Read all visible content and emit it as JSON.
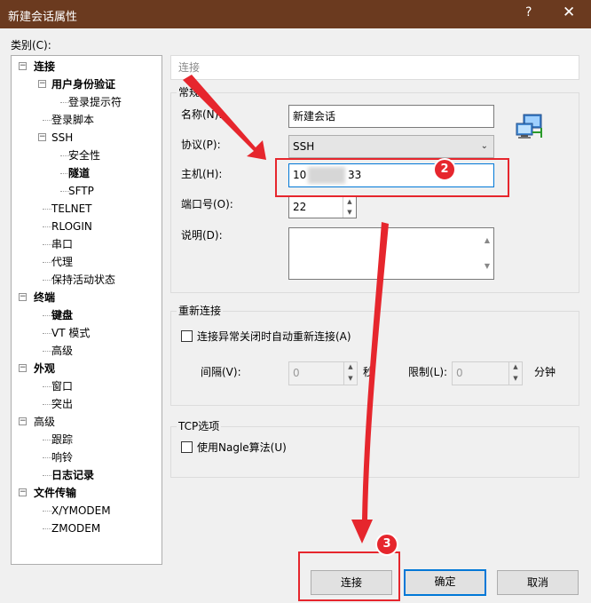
{
  "window": {
    "title": "新建会话属性",
    "help": "?",
    "close": "✕"
  },
  "category_label": "类别(C):",
  "tree": [
    {
      "label": "连接",
      "level": 0,
      "bold": true
    },
    {
      "label": "用户身份验证",
      "level": 1,
      "bold": true
    },
    {
      "label": "登录提示符",
      "level": 2,
      "bold": false
    },
    {
      "label": "登录脚本",
      "level": 1,
      "bold": false
    },
    {
      "label": "SSH",
      "level": 1,
      "bold": false
    },
    {
      "label": "安全性",
      "level": 2,
      "bold": false
    },
    {
      "label": "隧道",
      "level": 2,
      "bold": true
    },
    {
      "label": "SFTP",
      "level": 2,
      "bold": false
    },
    {
      "label": "TELNET",
      "level": 1,
      "bold": false
    },
    {
      "label": "RLOGIN",
      "level": 1,
      "bold": false
    },
    {
      "label": "串口",
      "level": 1,
      "bold": false
    },
    {
      "label": "代理",
      "level": 1,
      "bold": false
    },
    {
      "label": "保持活动状态",
      "level": 1,
      "bold": false
    },
    {
      "label": "终端",
      "level": 0,
      "bold": true
    },
    {
      "label": "键盘",
      "level": 1,
      "bold": true
    },
    {
      "label": "VT 模式",
      "level": 1,
      "bold": false
    },
    {
      "label": "高级",
      "level": 1,
      "bold": false
    },
    {
      "label": "外观",
      "level": 0,
      "bold": true
    },
    {
      "label": "窗口",
      "level": 1,
      "bold": false
    },
    {
      "label": "突出",
      "level": 1,
      "bold": false
    },
    {
      "label": "高级",
      "level": 0,
      "bold": false
    },
    {
      "label": "跟踪",
      "level": 1,
      "bold": false
    },
    {
      "label": "响铃",
      "level": 1,
      "bold": false
    },
    {
      "label": "日志记录",
      "level": 1,
      "bold": true
    },
    {
      "label": "文件传输",
      "level": 0,
      "bold": true
    },
    {
      "label": "X/YMODEM",
      "level": 1,
      "bold": false
    },
    {
      "label": "ZMODEM",
      "level": 1,
      "bold": false
    }
  ],
  "header": "连接",
  "general": {
    "group_title": "常规",
    "name_label": "名称(N):",
    "name_value": "新建会话",
    "protocol_label": "协议(P):",
    "protocol_value": "SSH",
    "host_label": "主机(H):",
    "host_value_start": "10",
    "host_value_end": "33",
    "port_label": "端口号(O):",
    "port_value": "22",
    "desc_label": "说明(D):",
    "desc_value": ""
  },
  "reconnect": {
    "group_title": "重新连接",
    "checkbox_label": "连接异常关闭时自动重新连接(A)",
    "interval_label": "间隔(V):",
    "interval_value": "0",
    "interval_unit": "秒",
    "limit_label": "限制(L):",
    "limit_value": "0",
    "limit_unit": "分钟"
  },
  "tcp": {
    "group_title": "TCP选项",
    "nagle_label": "使用Nagle算法(U)"
  },
  "buttons": {
    "connect": "连接",
    "ok": "确定",
    "cancel": "取消"
  },
  "annotations": {
    "badge2": "2",
    "badge3": "3"
  },
  "colors": {
    "titlebar": "#6b3a1f",
    "annotation": "#e6262d",
    "focus": "#0078d7"
  }
}
